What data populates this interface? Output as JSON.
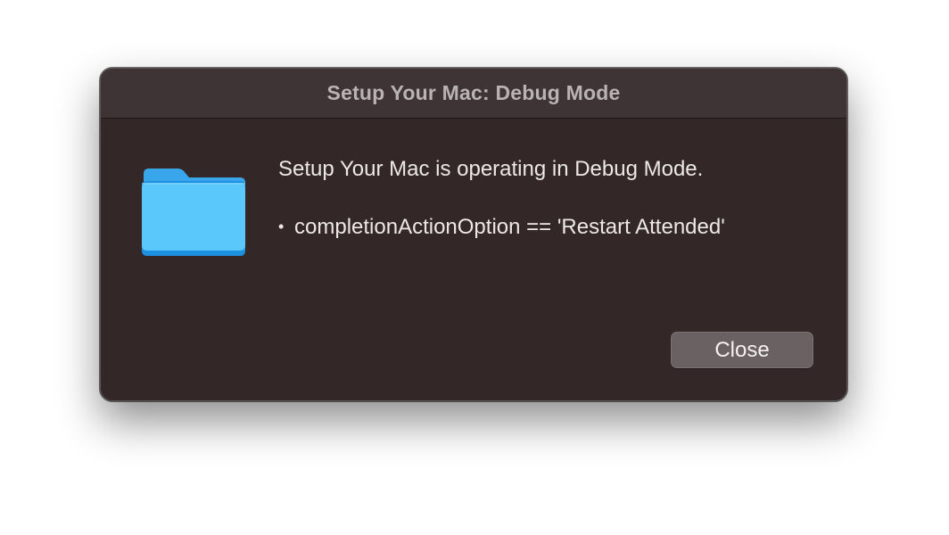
{
  "window": {
    "title": "Setup Your Mac: Debug Mode"
  },
  "icon": {
    "name": "folder-icon",
    "color": "#5ac8fa"
  },
  "message": {
    "line1": "Setup Your Mac is operating in Debug Mode.",
    "bullet": "•",
    "line2": "completionActionOption == 'Restart Attended'"
  },
  "buttons": {
    "close_label": "Close"
  },
  "colors": {
    "dialog_background": "#332728",
    "titlebar_background": "#3e3435",
    "button_background": "#6a6162",
    "title_text": "#b9b3b4",
    "body_text": "#ece8e8"
  }
}
